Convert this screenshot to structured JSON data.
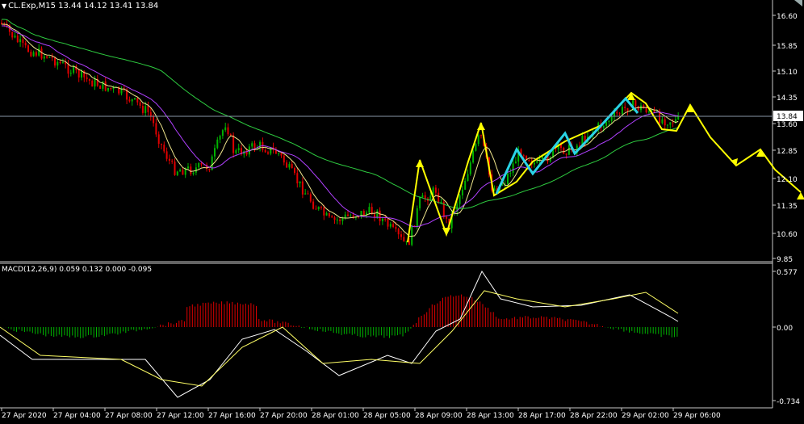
{
  "main_chart": {
    "symbol_line": "CL.Exp,M15  13.44 14.12 13.41 13.84",
    "menu_glyph": "▼",
    "price_axis": [
      "16.60",
      "15.85",
      "15.10",
      "14.35",
      "13.60",
      "12.85",
      "12.10",
      "11.35",
      "10.60",
      "9.85"
    ],
    "current_price": "13.84"
  },
  "macd_panel": {
    "label": "MACD(12,26,9) 0.059 0.132 0.000 -0.095",
    "axis": [
      "0.577",
      "0.00",
      "-0.734"
    ]
  },
  "time_axis": [
    "27 Apr 2020",
    "27 Apr 04:00",
    "27 Apr 08:00",
    "27 Apr 12:00",
    "27 Apr 16:00",
    "27 Apr 20:00",
    "28 Apr 01:00",
    "28 Apr 05:00",
    "28 Apr 09:00",
    "28 Apr 13:00",
    "28 Apr 17:00",
    "28 Apr 22:00",
    "29 Apr 02:00",
    "29 Apr 06:00"
  ],
  "colors": {
    "background": "#000000",
    "bull": "#00b300",
    "bear": "#e00000",
    "ma_fast": "#f0e68c",
    "ma_mid": "#b040ff",
    "ma_slow": "#2ecc40",
    "arrows": "#ffff00",
    "wave": "#29d3e6",
    "grid_axis": "#c8c8c8",
    "bid_line": "#8a98a8",
    "macd_line": "#ffffff",
    "signal_line": "#ffff66"
  },
  "icons": [
    "dropdown-arrow-icon",
    "trend-arrow-icon"
  ]
}
